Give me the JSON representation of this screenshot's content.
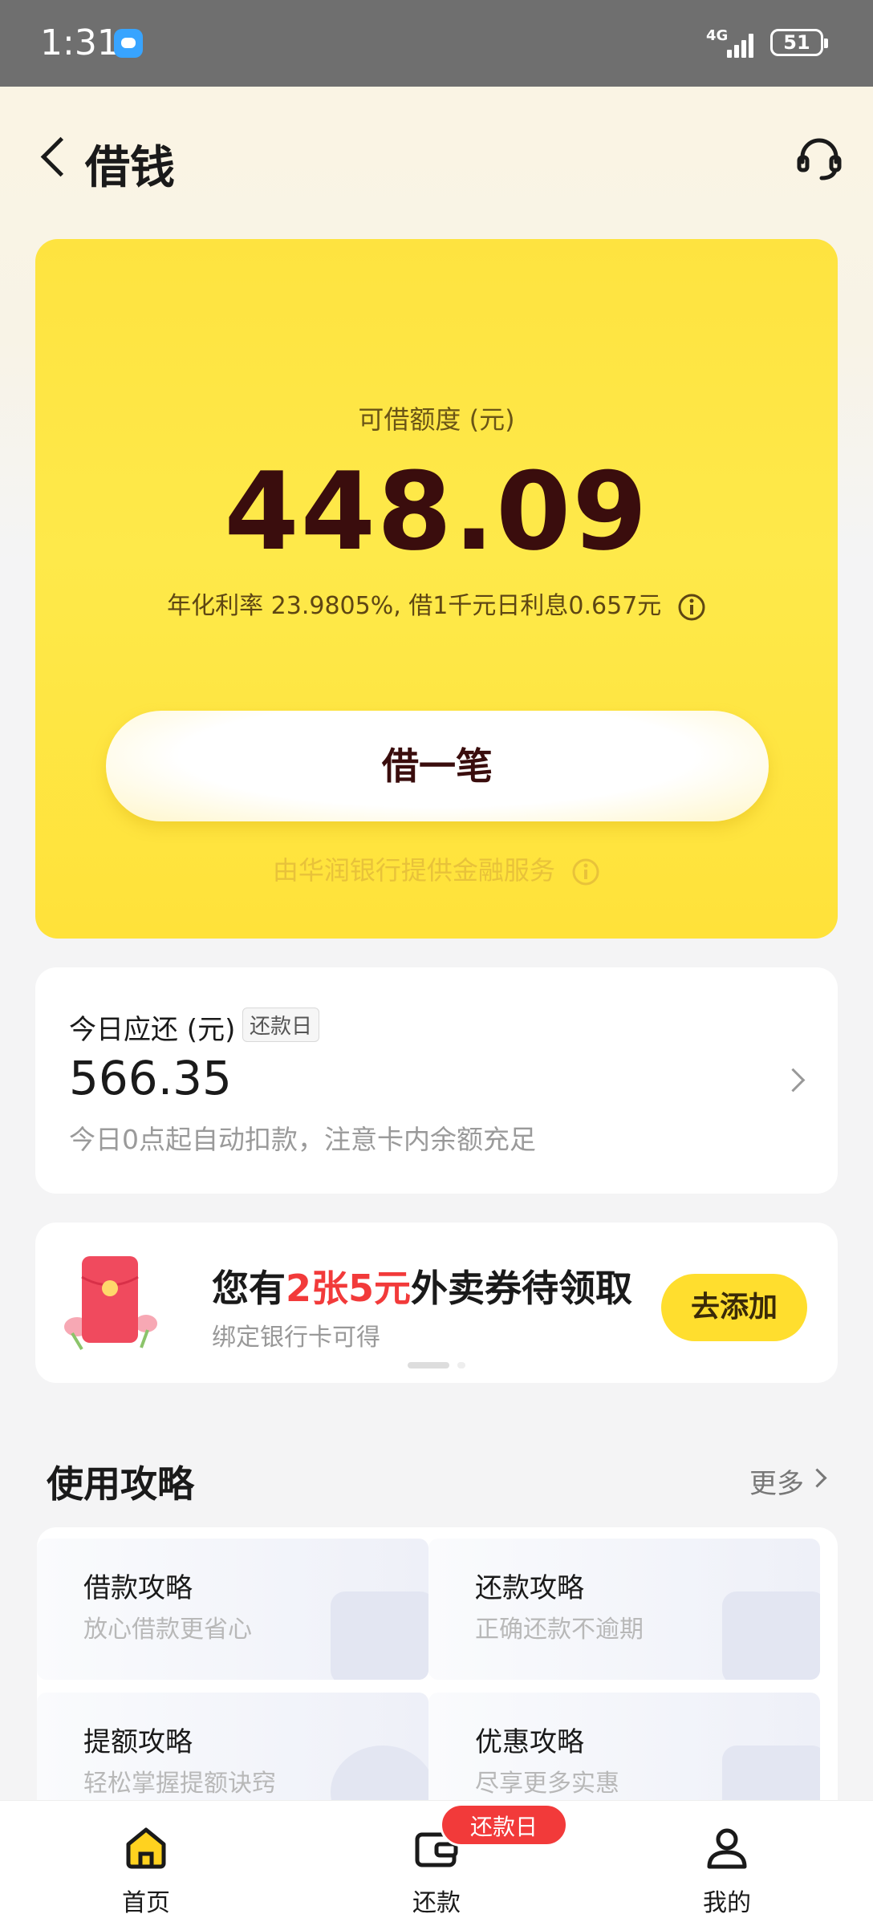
{
  "status_bar": {
    "time": "1:31",
    "network": "4G",
    "battery": "51"
  },
  "header": {
    "title": "借钱"
  },
  "loan_card": {
    "limit_label": "可借额度 (元)",
    "limit_value": "448.09",
    "rate_text": "年化利率 23.9805%, 借1千元日利息0.657元",
    "borrow_button": "借一笔",
    "provider_text": "由华润银行提供金融服务"
  },
  "due_card": {
    "label": "今日应还 (元)",
    "tag": "还款日",
    "amount": "566.35",
    "note": "今日0点起自动扣款，注意卡内余额充足"
  },
  "promo": {
    "title_prefix": "您有",
    "title_highlight": "2张5元",
    "title_suffix": "外卖券待领取",
    "subtitle": "绑定银行卡可得",
    "button": "去添加"
  },
  "guide": {
    "title": "使用攻略",
    "more": "更多",
    "items": [
      {
        "title": "借款攻略",
        "subtitle": "放心借款更省心"
      },
      {
        "title": "还款攻略",
        "subtitle": "正确还款不逾期"
      },
      {
        "title": "提额攻略",
        "subtitle": "轻松掌握提额诀窍"
      },
      {
        "title": "优惠攻略",
        "subtitle": "尽享更多实惠"
      }
    ]
  },
  "tabbar": {
    "items": [
      {
        "label": "首页",
        "icon": "home-icon"
      },
      {
        "label": "还款",
        "icon": "wallet-icon"
      },
      {
        "label": "我的",
        "icon": "profile-icon"
      }
    ],
    "repay_badge": "还款日"
  },
  "colors": {
    "accent_yellow": "#fee340",
    "highlight_red": "#f23a3a",
    "deep_brown": "#3a0d0d"
  }
}
